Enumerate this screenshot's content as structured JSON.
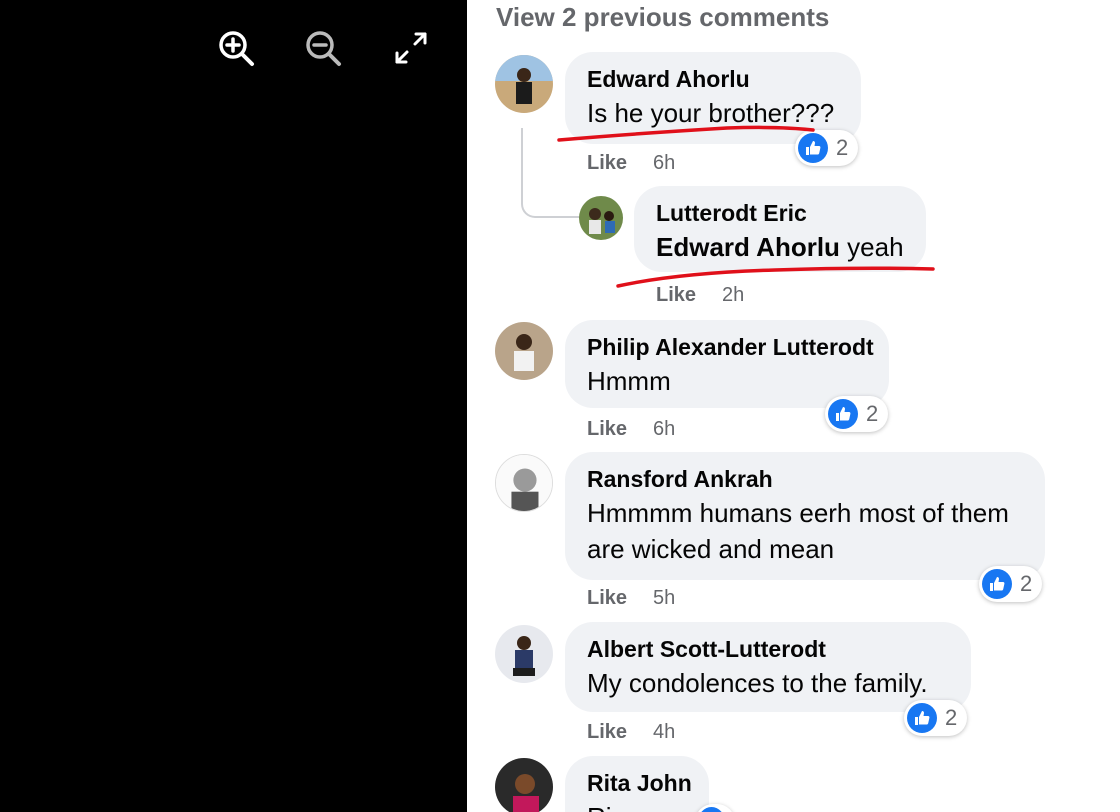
{
  "viewer": {
    "zoom_in_icon": "zoom-in-icon",
    "zoom_out_icon": "zoom-out-icon",
    "fullscreen_icon": "expand-icon"
  },
  "comments_panel": {
    "view_previous": "View 2 previous comments",
    "like_label": "Like",
    "reaction_icon": "thumbs-up-icon",
    "comments": [
      {
        "author": "Edward Ahorlu",
        "text": "Is he your brother???",
        "time": "6h",
        "reactions": "2"
      },
      {
        "author": "Lutterodt Eric",
        "mention": "Edward Ahorlu",
        "text": " yeah",
        "time": "2h",
        "is_reply": true
      },
      {
        "author": "Philip Alexander Lutterodt",
        "text": "Hmmm",
        "time": "6h",
        "reactions": "2"
      },
      {
        "author": "Ransford Ankrah",
        "text": "Hmmmm humans eerh most of them are wicked and mean",
        "time": "5h",
        "reactions": "2"
      },
      {
        "author": "Albert Scott-Lutterodt",
        "text": "My condolences to the family.",
        "time": "4h",
        "reactions": "2"
      },
      {
        "author": "Rita John",
        "text": "Rip"
      }
    ]
  },
  "colors": {
    "bubble": "#f0f2f5",
    "like_blue": "#1877f2",
    "annotation_red": "#e0101a",
    "meta_gray": "#65676b"
  }
}
